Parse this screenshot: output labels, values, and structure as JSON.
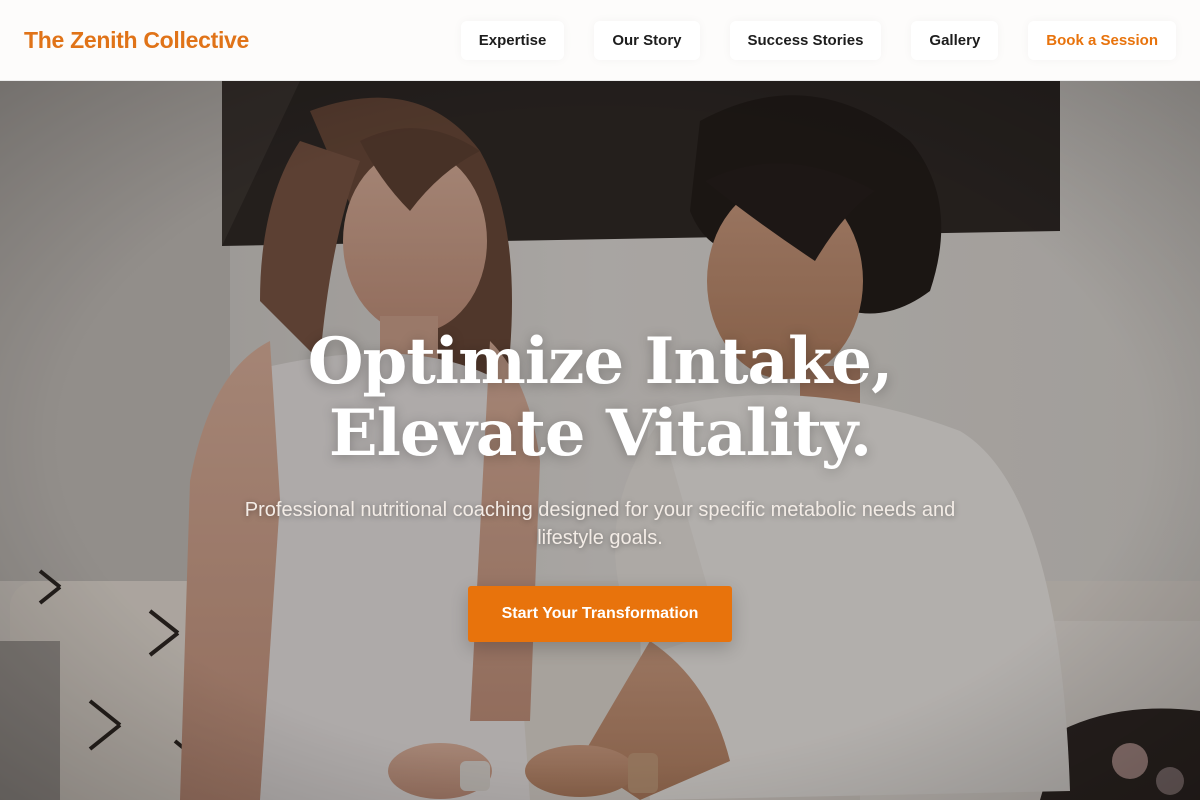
{
  "theme": {
    "accent": "#e8730c",
    "brand_color": "#e07318",
    "nav_text": "#1d1d1d"
  },
  "header": {
    "brand": "The Zenith Collective",
    "nav": [
      {
        "label": "Expertise"
      },
      {
        "label": "Our Story"
      },
      {
        "label": "Success Stories"
      },
      {
        "label": "Gallery"
      }
    ],
    "cta_label": "Book a Session"
  },
  "hero": {
    "title_line1": "Optimize Intake,",
    "title_line2": "Elevate Vitality.",
    "subtitle": "Professional nutritional coaching designed for your specific metabolic needs and lifestyle goals.",
    "button_label": "Start Your Transformation",
    "image_description_icon": "photo-two-women-measuring"
  }
}
